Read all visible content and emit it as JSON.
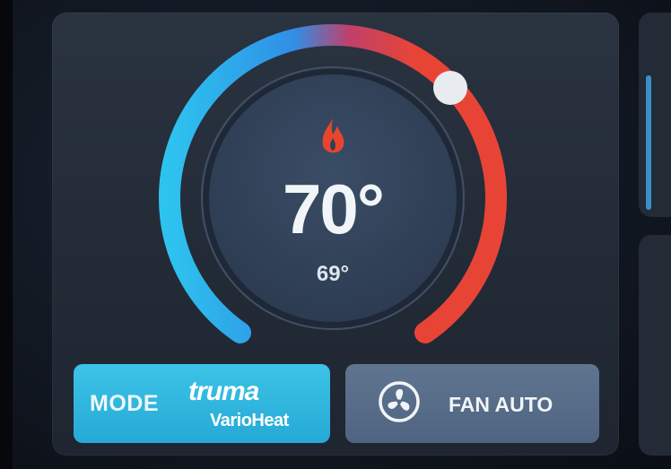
{
  "thermostat": {
    "setpoint": "70°",
    "current_temp": "69°",
    "heat_icon": "flame-icon",
    "colors": {
      "arc_cold": "#2ec3ee",
      "arc_warm": "#e84436",
      "accent_active": "#36bde4",
      "button_inactive": "#566b86"
    }
  },
  "controls": {
    "mode": {
      "label": "MODE",
      "brand": "truma",
      "brand_sub": "VarioHeat"
    },
    "fan": {
      "label": "FAN AUTO",
      "icon": "fan-icon"
    }
  }
}
